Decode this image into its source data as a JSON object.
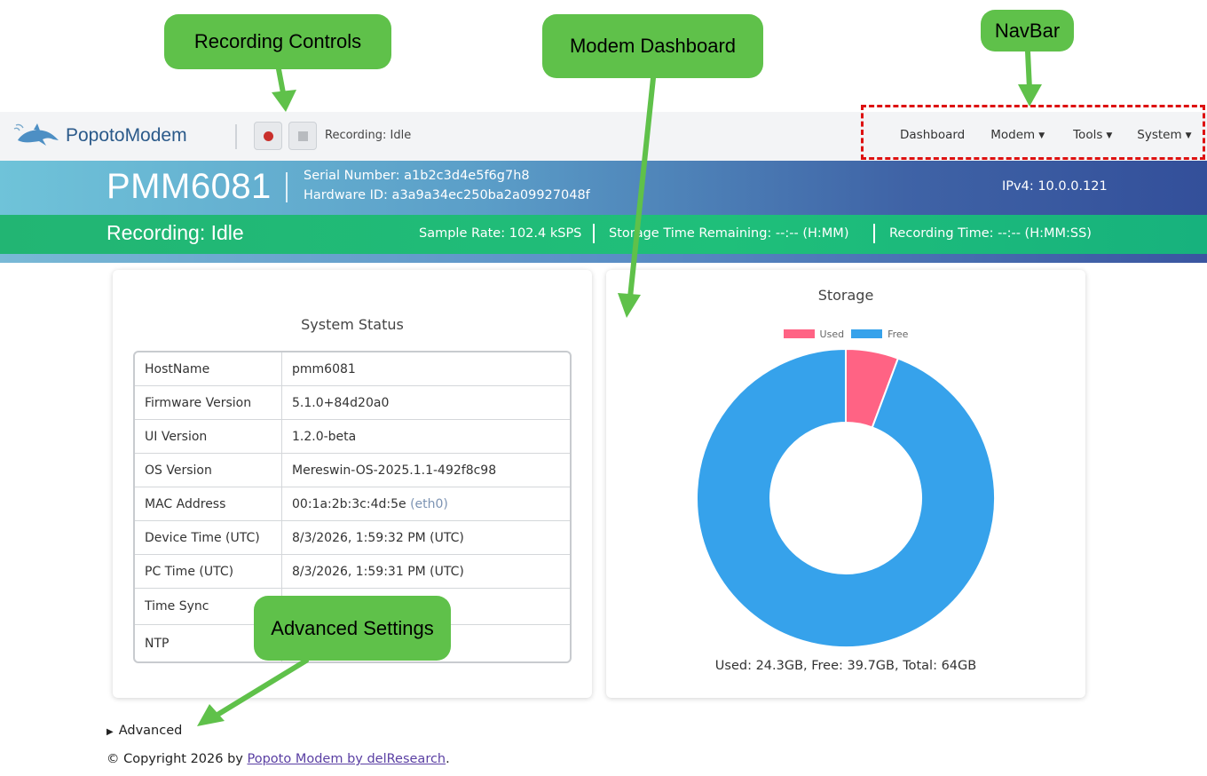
{
  "navbar": {
    "brand_part1": "Popoto",
    "brand_part2": "Modem",
    "recording_status": "Recording: Idle",
    "menu": [
      {
        "label": "Dashboard",
        "dropdown": false
      },
      {
        "label": "Modem",
        "dropdown": true
      },
      {
        "label": "Tools",
        "dropdown": true
      },
      {
        "label": "System",
        "dropdown": true
      }
    ]
  },
  "header": {
    "device_name": "PMM6081",
    "serial": "Serial Number: a1b2c3d4e5f6g7h8",
    "hardware_id": "Hardware ID: a3a9a34ec250ba2a09927048f",
    "ipv4": "IPv4: 10.0.0.121"
  },
  "status_band": {
    "recording": "Recording: Idle",
    "sample_rate": "Sample Rate: 102.4 kSPS",
    "storage_remaining": "Storage Time Remaining: --:--  (H:MM)",
    "recording_time": "Recording Time: --:-- (H:MM:SS)"
  },
  "system_status": {
    "title": "System Status",
    "rows": [
      {
        "key": "HostName",
        "value": "pmm6081"
      },
      {
        "key": "Firmware Version",
        "value": "5.1.0+84d20a0"
      },
      {
        "key": "UI Version",
        "value": "1.2.0-beta"
      },
      {
        "key": "OS Version",
        "value": "Mereswin-OS-2025.1.1-492f8c98"
      },
      {
        "key": "MAC Address",
        "value": "00:1a:2b:3c:4d:5e",
        "suffix": "(eth0)"
      },
      {
        "key": "Device Time (UTC)",
        "value": "8/3/2026, 1:59:32 PM (UTC)"
      },
      {
        "key": "PC Time (UTC)",
        "value": "8/3/2026, 1:59:31 PM (UTC)"
      },
      {
        "key": "Time Sync",
        "value": ""
      },
      {
        "key": "NTP",
        "value": ""
      }
    ]
  },
  "storage": {
    "title": "Storage",
    "summary": "Used: 24.3GB, Free: 39.7GB, Total: 64GB"
  },
  "chart_data": {
    "type": "pie",
    "title": "Storage",
    "categories": [
      "Used",
      "Free"
    ],
    "values": [
      2.4,
      39.7
    ],
    "colors": [
      "#ff6384",
      "#36a2eb"
    ],
    "legend_position": "top",
    "donut": true
  },
  "footer": {
    "advanced_label": "Advanced",
    "copyright_prefix": "© Copyright 2026 by ",
    "copyright_link": "Popoto Modem by delResearch",
    "copyright_suffix": "."
  },
  "annotations": {
    "recording_controls": "Recording Controls",
    "modem_dashboard": "Modem Dashboard",
    "navbar": "NavBar",
    "advanced_settings": "Advanced Settings"
  },
  "colors": {
    "accent_green": "#5fc14a",
    "nav_highlight": "#dd1111",
    "record_red": "#c9302c"
  }
}
